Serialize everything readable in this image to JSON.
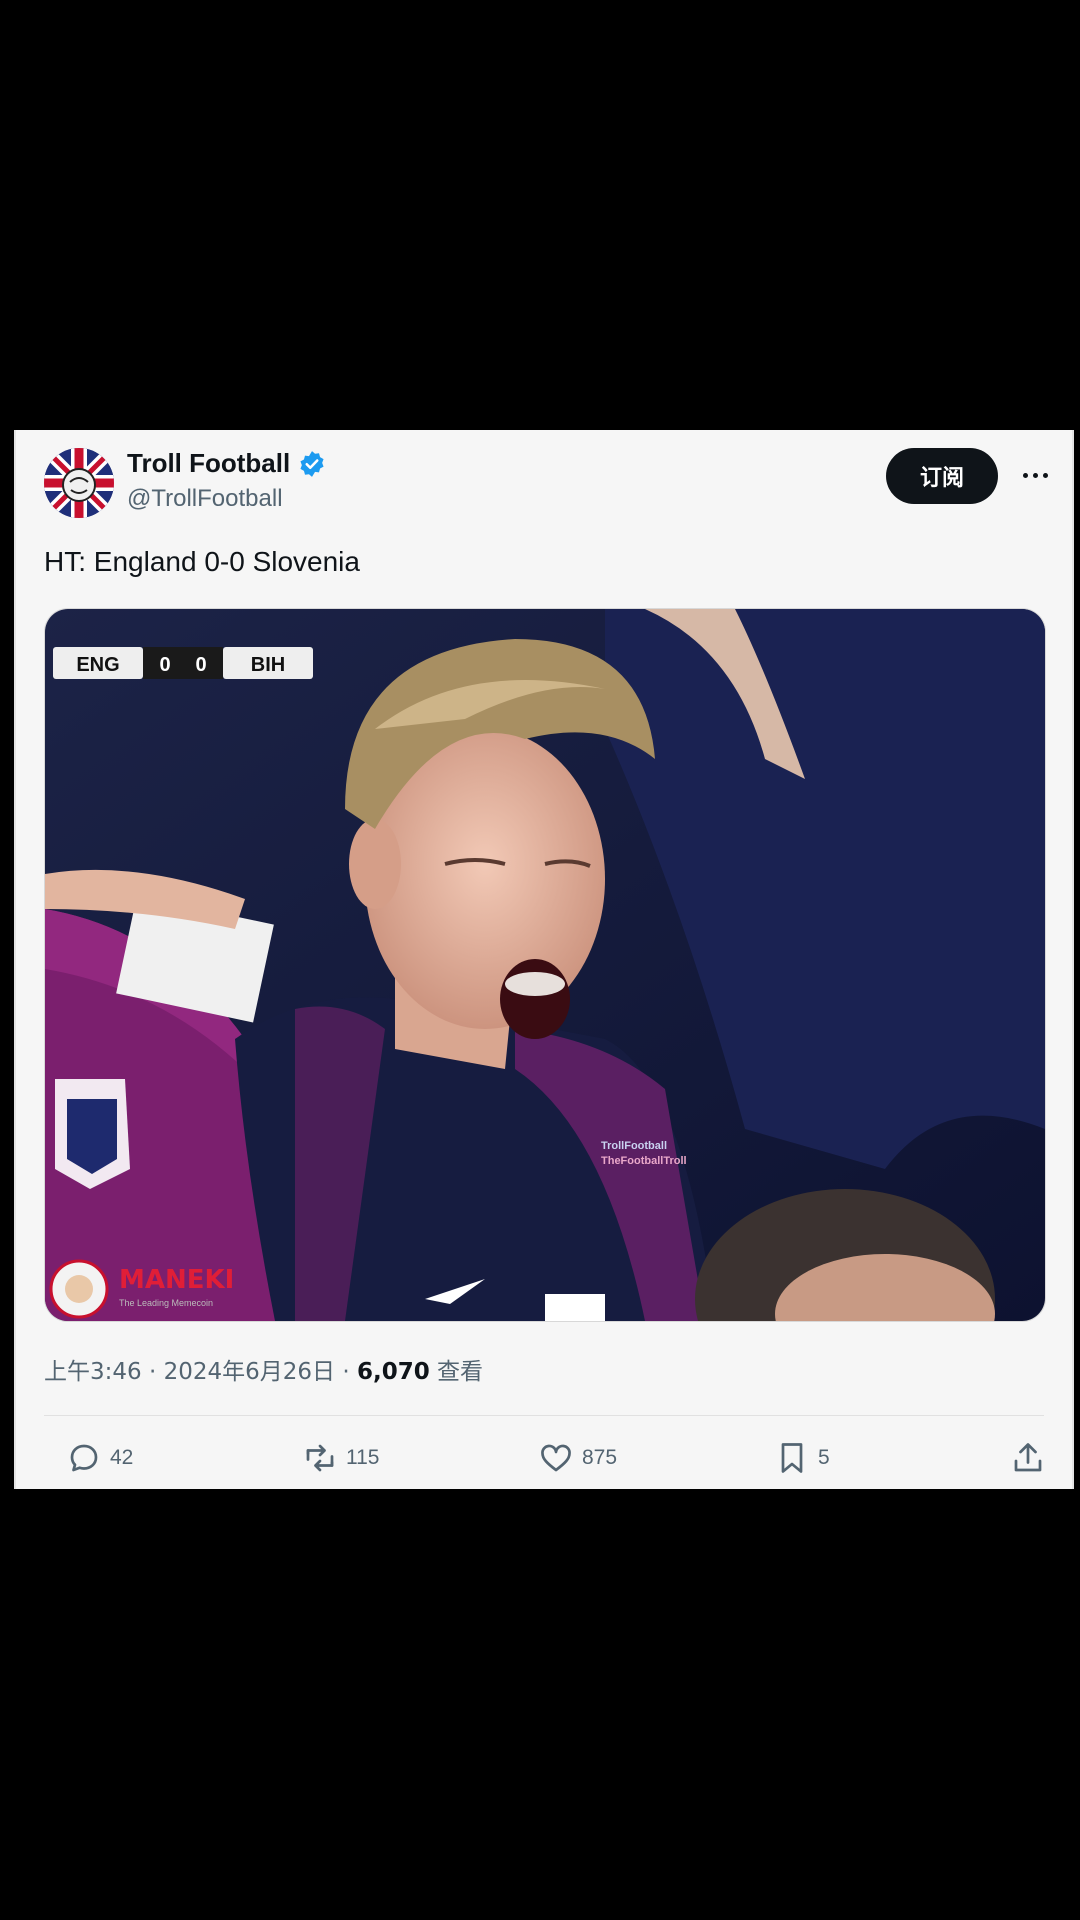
{
  "tweet": {
    "author_name": "Troll Football",
    "handle": "@TrollFootball",
    "subscribe_label": "订阅",
    "text": "HT: England 0-0 Slovenia",
    "media": {
      "scoreboard": {
        "home": "ENG",
        "home_score": "0",
        "away_score": "0",
        "away": "BIH"
      },
      "watermark_line1": "TrollFootball",
      "watermark_line2": "TheFootballTroll",
      "sponsor_name": "MANEKI",
      "sponsor_tagline": "The Leading Memecoin"
    },
    "timestamp": "上午3:46 · 2024年6月26日",
    "views_count": "6,070",
    "views_label": "查看",
    "replies": "42",
    "retweets": "115",
    "likes": "875",
    "bookmarks": "5"
  },
  "colors": {
    "accent_verified": "#1d9bf0",
    "text_primary": "#0f1419",
    "text_secondary": "#536471"
  },
  "icons": [
    "verified-badge-icon",
    "more-icon",
    "reply-icon",
    "retweet-icon",
    "like-icon",
    "bookmark-icon",
    "share-icon"
  ]
}
